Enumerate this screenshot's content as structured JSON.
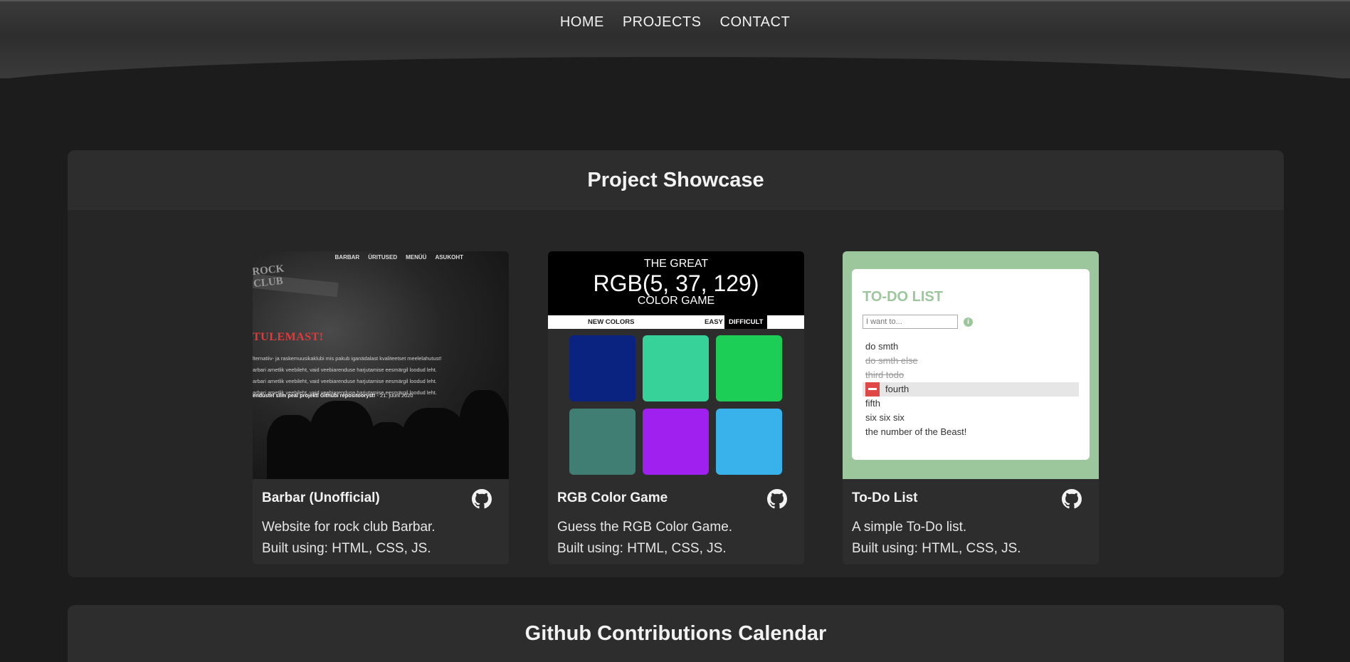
{
  "nav": {
    "items": [
      "HOME",
      "PROJECTS",
      "CONTACT"
    ]
  },
  "showcase": {
    "title": "Project Showcase"
  },
  "calendar": {
    "title": "Github Contributions Calendar"
  },
  "cards": [
    {
      "title": "Barbar (Unofficial)",
      "desc_line1": "Website for rock club Barbar.",
      "desc_line2": "Built using: HTML, CSS, JS.",
      "icon": "github-icon",
      "thumb": {
        "nav": [
          "BARBAR",
          "ÜRITUSED",
          "MENÜÜ",
          "ASUKOHT"
        ],
        "logo": "ROCK CLUB",
        "heading": "TULEMAST!",
        "lines": [
          "lternatiiv- ja raskemuusikaklubi mis pakub iganädalast kvaliteetset meelelahutust!",
          "arbari ametlik veebileht, vaid veebiarenduse harjutamise eesmärgil loodud leht.",
          "arbari ametlik veebileht, vaid veebiarenduse harjutamise eesmärgil loodud leht.",
          "arbari ametlik veebileht, vaid veebiarenduse harjutamise eesmärgil loodud leht."
        ],
        "footer_bold": "endustel silm peal projekti Githubi repositooryst!",
        "footer_date": "- 21. juuni 2020"
      }
    },
    {
      "title": "RGB Color Game",
      "desc_line1": "Guess the RGB Color Game.",
      "desc_line2": "Built using: HTML, CSS, JS.",
      "icon": "github-icon",
      "thumb": {
        "line1": "THE GREAT",
        "line2": "RGB(5, 37, 129)",
        "line3": "COLOR GAME",
        "new_colors": "NEW COLORS",
        "easy": "EASY",
        "difficult": "DIFFICULT",
        "squares": [
          "#0b2380",
          "#36d299",
          "#1ccd56",
          "#407e74",
          "#a020f0",
          "#39b2ec"
        ]
      }
    },
    {
      "title": "To-Do List",
      "desc_line1": "A simple To-Do list.",
      "desc_line2": "Built using: HTML, CSS, JS.",
      "icon": "github-icon",
      "thumb": {
        "title": "TO-DO LIST",
        "placeholder": "I want to...",
        "items": [
          {
            "text": "do smth",
            "done": false
          },
          {
            "text": "do smth else",
            "done": true
          },
          {
            "text": "third todo",
            "done": true
          },
          {
            "text": "fourth",
            "done": false,
            "hover": true
          },
          {
            "text": "fifth",
            "done": false
          },
          {
            "text": "six six six",
            "done": false
          },
          {
            "text": "the number of the Beast!",
            "done": false
          }
        ]
      }
    }
  ],
  "colors": {
    "background": "#1c1c1c",
    "panel": "#262626",
    "card": "#2d2d2d",
    "todo_accent": "#9cc69b",
    "todo_delete": "#e04747"
  }
}
